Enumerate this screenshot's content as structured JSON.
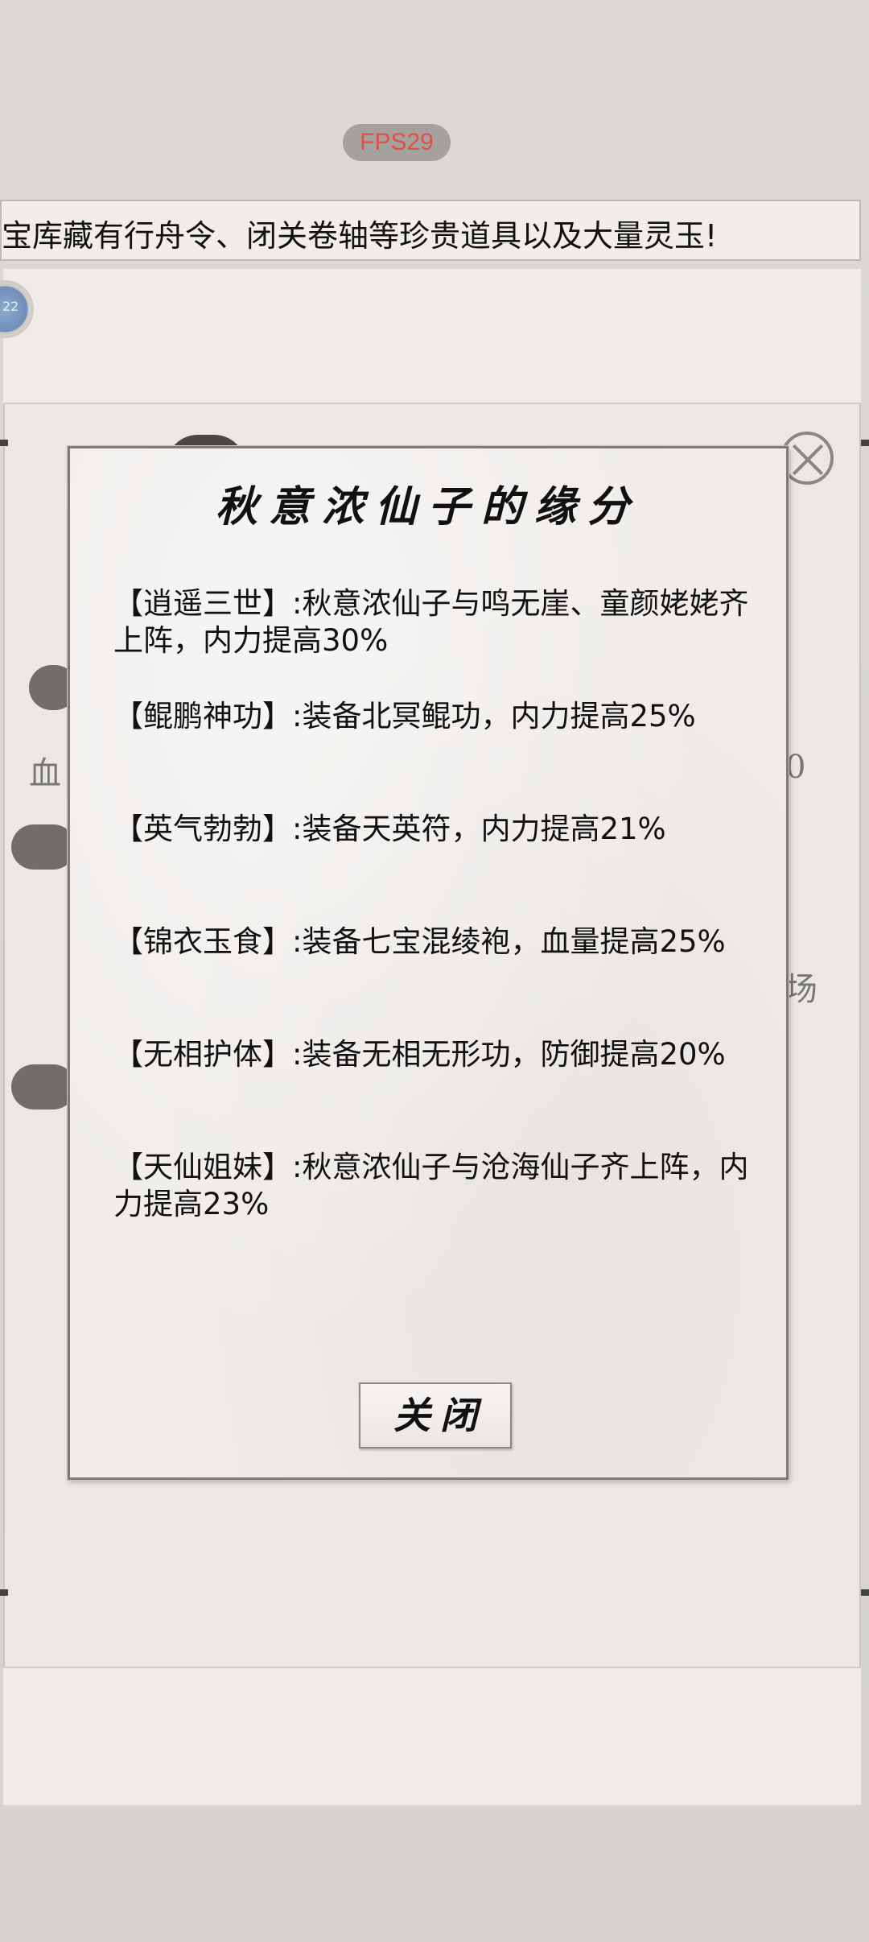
{
  "hud": {
    "fps_label": "FPS29"
  },
  "ticker": {
    "text": "宝库藏有行舟令、闭关卷轴等珍贵道具以及大量灵玉!"
  },
  "background": {
    "avatar_badge": "22",
    "char_left": "血",
    "char_right": "0",
    "char_right2": "场"
  },
  "dialog": {
    "title": "秋意浓仙子的缘分",
    "bonds": [
      "【逍遥三世】:秋意浓仙子与鸣无崖、童颜姥姥齐上阵，内力提高30%",
      "【鲲鹏神功】:装备北冥鲲功，内力提高25%",
      "【英气勃勃】:装备天英符，内力提高21%",
      "【锦衣玉食】:装备七宝混绫袍，血量提高25%",
      "【无相护体】:装备无相无形功，防御提高20%",
      "【天仙姐妹】:秋意浓仙子与沧海仙子齐上阵，内力提高23%"
    ],
    "close_label": "关闭"
  }
}
